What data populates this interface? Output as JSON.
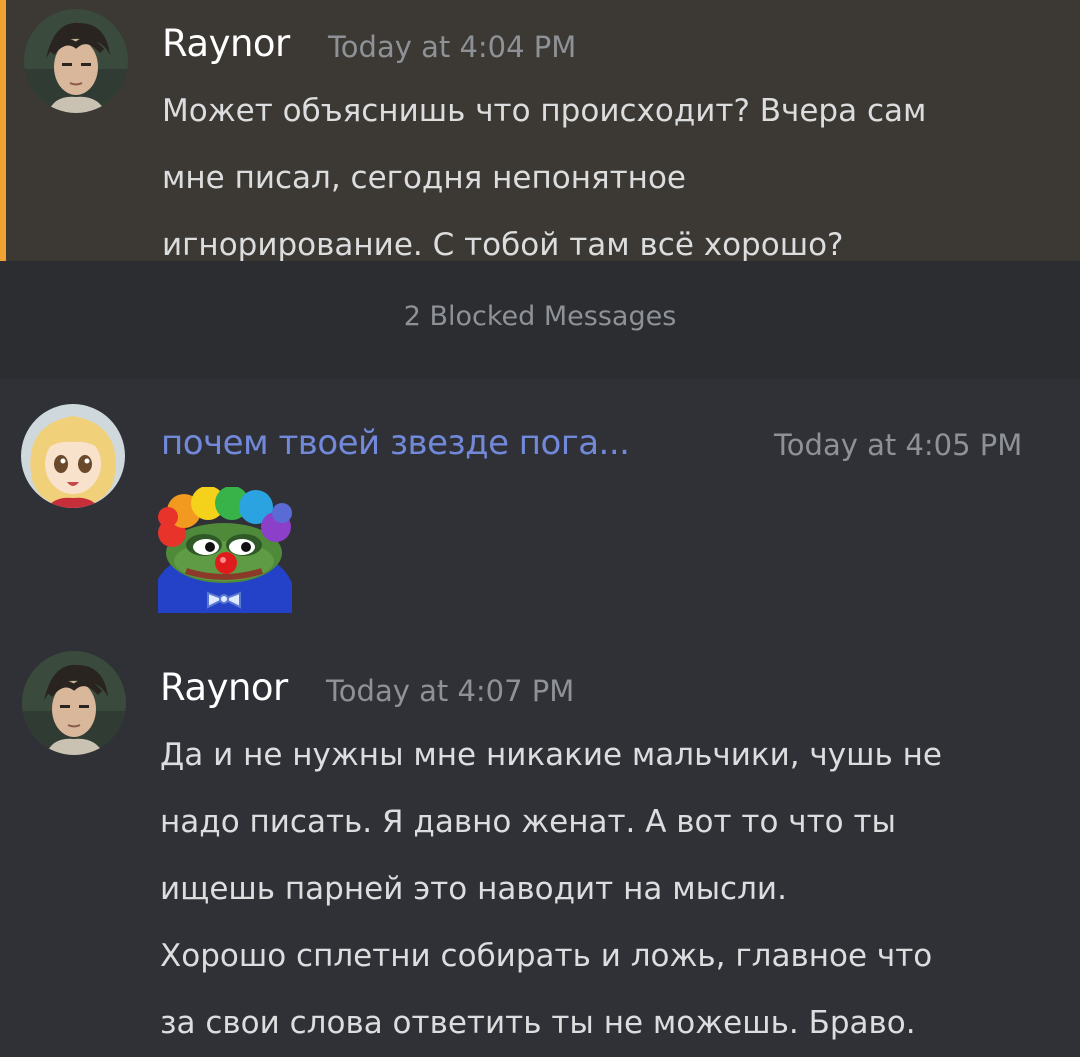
{
  "messages": [
    {
      "username": "Raynor",
      "timestamp": "Today at 4:04 PM",
      "text": "Может объяснишь что происходит? Вчера сам\nмне писал, сегодня непонятное\nигнорирование. С тобой там всё хорошо?",
      "avatar": "anime-man-avatar",
      "highlight_color": "#f0a232"
    },
    {
      "username": "почем твоей звезде пога...",
      "timestamp": "Today at 4:05 PM",
      "sticker": "clown-pepe-sticker",
      "avatar": "anime-girl-avatar"
    },
    {
      "username": "Raynor",
      "timestamp": "Today at 4:07 PM",
      "text": "Да и не нужны мне никакие мальчики, чушь не\nнадо писать. Я давно женат. А вот то что ты\nищешь парней это наводит на мысли.\nХорошо сплетни собирать и ложь, главное что\nза свои слова ответить ты не можешь. Браво.",
      "avatar": "anime-man-avatar"
    }
  ],
  "blocked": {
    "label": "2 Blocked Messages"
  },
  "colors": {
    "background": "#2f3136",
    "mention_background": "#3c3934",
    "mention_bar": "#f0a232",
    "blocked_background": "#2b2d31",
    "username_role": "#7289da",
    "timestamp": "#8e9297"
  }
}
